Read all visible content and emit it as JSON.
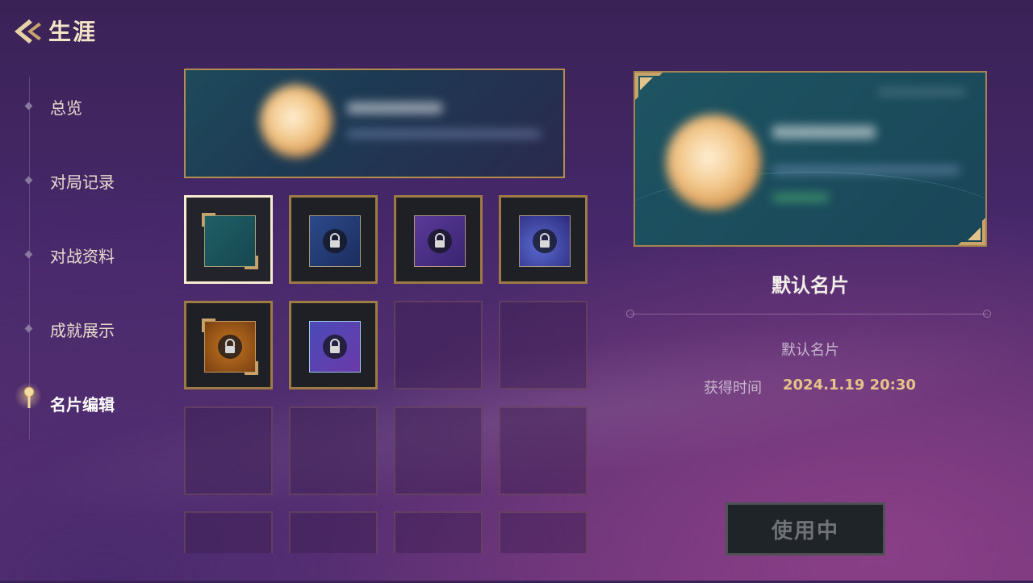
{
  "header": {
    "title": "生涯",
    "back_icon": "back-chevron-icon"
  },
  "sidebar": {
    "items": [
      {
        "label": "总览",
        "active": false
      },
      {
        "label": "对局记录",
        "active": false
      },
      {
        "label": "对战资料",
        "active": false
      },
      {
        "label": "成就展示",
        "active": false
      },
      {
        "label": "名片编辑",
        "active": true,
        "icon": "pin-icon"
      }
    ]
  },
  "card_grid": {
    "slots": [
      {
        "state": "selected",
        "theme": "teal"
      },
      {
        "state": "locked",
        "theme": "blue-ornate"
      },
      {
        "state": "locked",
        "theme": "purple-ornate"
      },
      {
        "state": "locked",
        "theme": "cosmic-ornate"
      },
      {
        "state": "locked",
        "theme": "amber"
      },
      {
        "state": "locked",
        "theme": "violet-dragon"
      },
      {
        "state": "empty"
      },
      {
        "state": "empty"
      },
      {
        "state": "empty"
      },
      {
        "state": "empty"
      },
      {
        "state": "empty"
      },
      {
        "state": "empty"
      },
      {
        "state": "empty"
      },
      {
        "state": "empty"
      },
      {
        "state": "empty"
      },
      {
        "state": "empty"
      }
    ]
  },
  "detail": {
    "name": "默认名片",
    "description": "默认名片",
    "acquired_label": "获得时间",
    "acquired_value": "2024.1.19  20:30",
    "use_button": "使用中"
  },
  "colors": {
    "gold": "#b48c4e",
    "accent_text": "#e5c489",
    "selected_border": "#f7ecd0"
  }
}
